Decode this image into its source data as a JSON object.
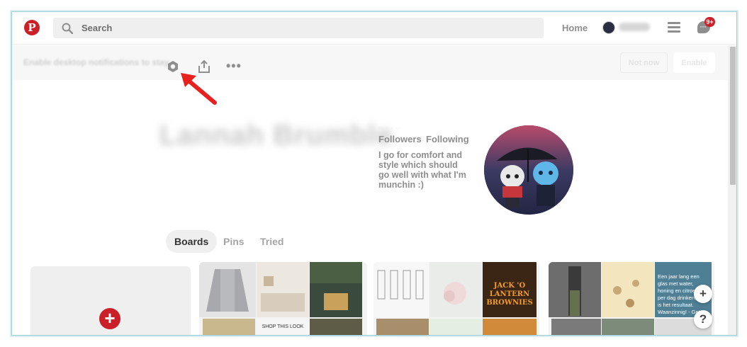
{
  "header": {
    "logo_letter": "P",
    "search_placeholder": "Search",
    "home_label": "Home",
    "user_name": "Lannah",
    "notification_badge": "9+"
  },
  "notification_bar": {
    "message": "Enable desktop notifications to stay",
    "not_now_label": "Not now",
    "enable_label": "Enable"
  },
  "profile": {
    "name": "Lannah Brumble",
    "counts": "··  ·  ·  ··",
    "followers_label": "Followers",
    "following_label": "Following",
    "bio": "I go for comfort and style which should go well with what I'm munchin :)"
  },
  "tabs": [
    {
      "label": "Boards",
      "active": true
    },
    {
      "label": "Pins",
      "active": false
    },
    {
      "label": "Tried",
      "active": false
    }
  ],
  "create_board": {
    "plus": "+"
  },
  "boards": {
    "board2_label": "SHOP THIS LOOK",
    "board3_title": "JACK 'O LANTERN BROWNIES",
    "board4_text": "Een jaar lang een glas met water, honing en citroen per dag drinken, dit is het resultaat. Waanzinnig! - Get"
  },
  "fab": {
    "add": "+",
    "help": "?"
  },
  "colors": {
    "brand_red": "#cb2027",
    "muted_text": "#8e8e8e"
  }
}
